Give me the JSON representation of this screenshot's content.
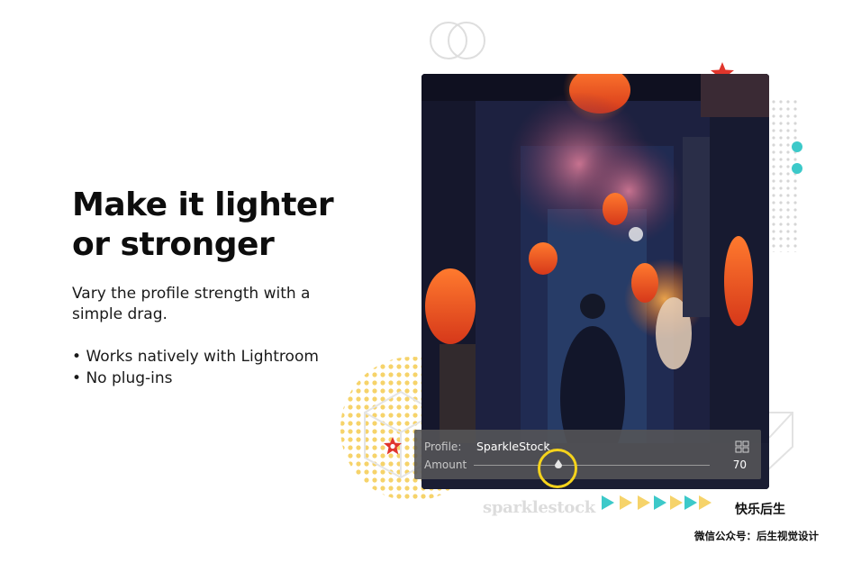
{
  "headline": {
    "line1": "Make it lighter",
    "line2": "or stronger"
  },
  "description": {
    "line1": "Vary the profile strength with a",
    "line2": "simple drag."
  },
  "bullets": [
    "Works natively with Lightroom",
    "No plug-ins"
  ],
  "panel": {
    "profile_label": "Profile:",
    "profile_value": "SparkleStock",
    "amount_label": "Amount",
    "amount_value": "70",
    "amount_level": 0.7
  },
  "watermark": {
    "text": "sparklestock"
  },
  "credits": {
    "brand_cn": "快乐后生",
    "wechat": "微信公众号：后生视觉设计"
  },
  "colors": {
    "headline": "#0d0d0d",
    "accent_yellow": "#f5d31c",
    "accent_teal": "#3cc9c9",
    "accent_red": "#e0352b",
    "panel_bg": "#555558"
  },
  "icons": [
    "two-circles-icon",
    "star-icon",
    "grid-icon",
    "dropdown-caret-icon",
    "slider-thumb-icon",
    "arrow-triangle-icon"
  ]
}
